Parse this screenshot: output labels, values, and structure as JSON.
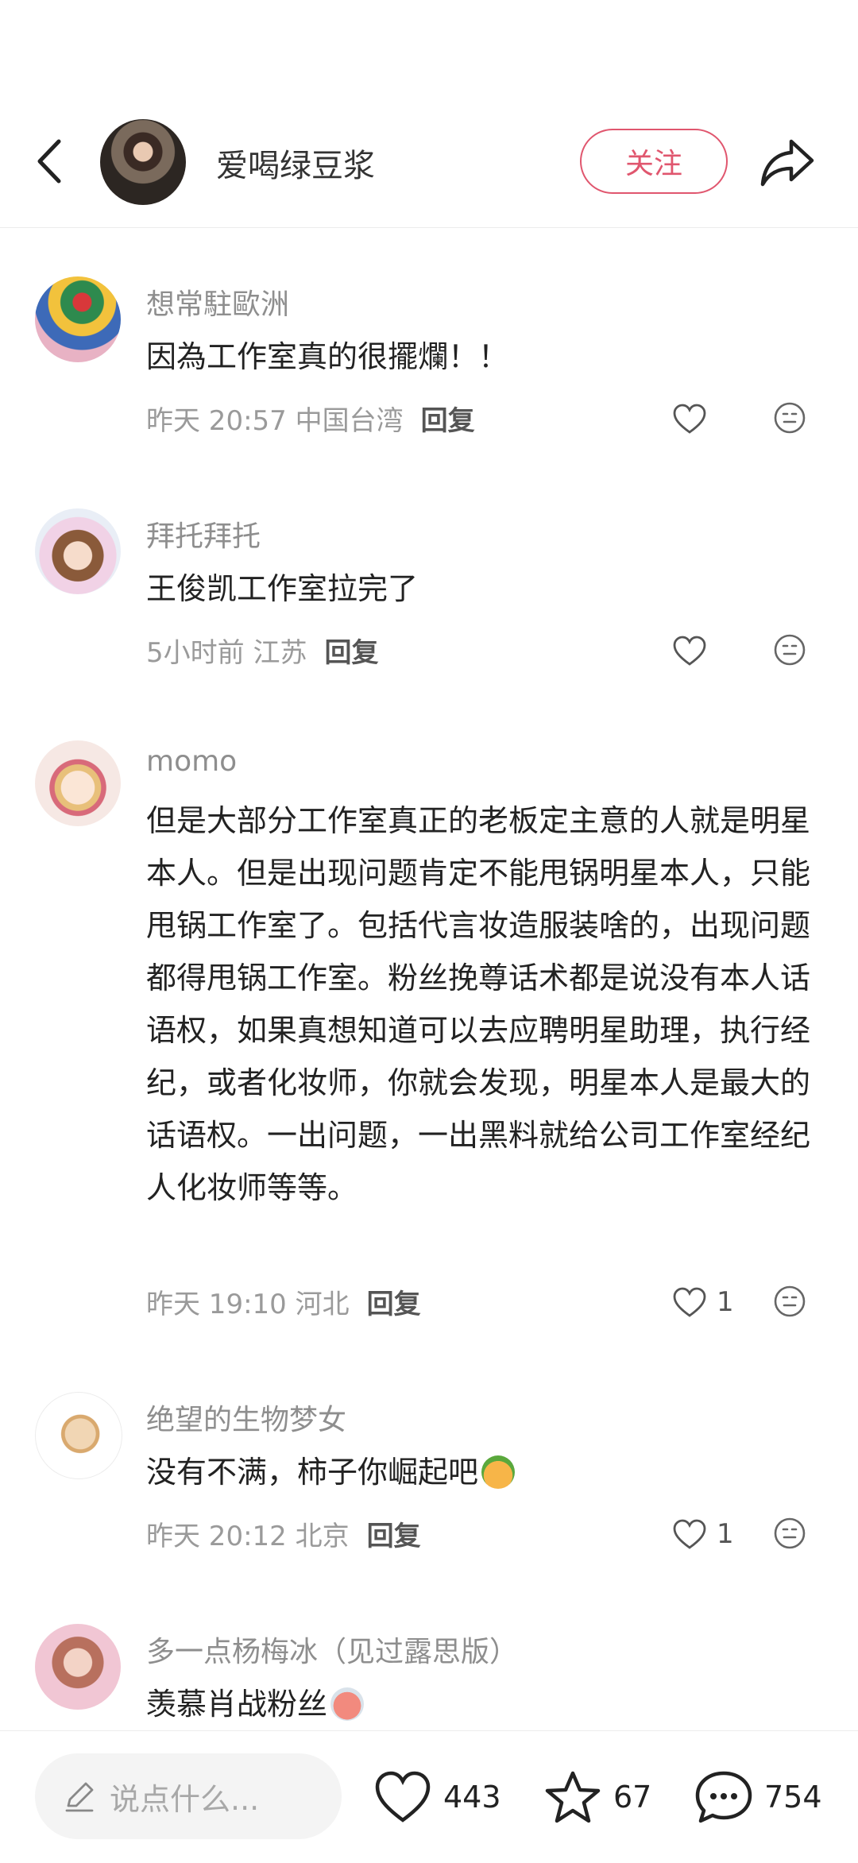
{
  "header": {
    "author_name": "爱喝绿豆浆",
    "follow_label": "关注"
  },
  "comments": [
    {
      "name": "想常駐歐洲",
      "text": "因為工作室真的很擺爛！！",
      "meta": "昨天 20:57 中国台湾",
      "reply_label": "回复",
      "likes": ""
    },
    {
      "name": "拜托拜托",
      "text": "王俊凯工作室拉完了",
      "meta": "5小时前 江苏",
      "reply_label": "回复",
      "likes": ""
    },
    {
      "name": "momo",
      "text": "但是大部分工作室真正的老板定主意的人就是明星本人。但是出现问题肯定不能甩锅明星本人，只能甩锅工作室了。包括代言妆造服装啥的，出现问题都得甩锅工作室。粉丝挽尊话术都是说没有本人话语权，如果真想知道可以去应聘明星助理，执行经纪，或者化妆师，你就会发现，明星本人是最大的话语权。一出问题，一出黑料就给公司工作室经纪人化妆师等等。",
      "meta": "昨天 19:10 河北",
      "reply_label": "回复",
      "likes": "1"
    },
    {
      "name": "绝望的生物梦女",
      "text": "没有不满，柿子你崛起吧",
      "meta": "昨天 20:12 北京",
      "reply_label": "回复",
      "likes": "1"
    },
    {
      "name": "多一点杨梅冰（见过露思版）",
      "text": "羡慕肖战粉丝",
      "meta": "",
      "reply_label": "",
      "likes": ""
    }
  ],
  "bottom_bar": {
    "input_placeholder": "说点什么...",
    "likes": "443",
    "favorites": "67",
    "comments": "754"
  },
  "colors": {
    "accent": "#e0566e",
    "secondary_text": "#9a9a9a"
  },
  "icons": [
    "back-arrow-icon",
    "share-icon",
    "heart-icon",
    "reaction-face-icon",
    "pencil-icon",
    "star-icon",
    "comment-bubble-icon"
  ]
}
